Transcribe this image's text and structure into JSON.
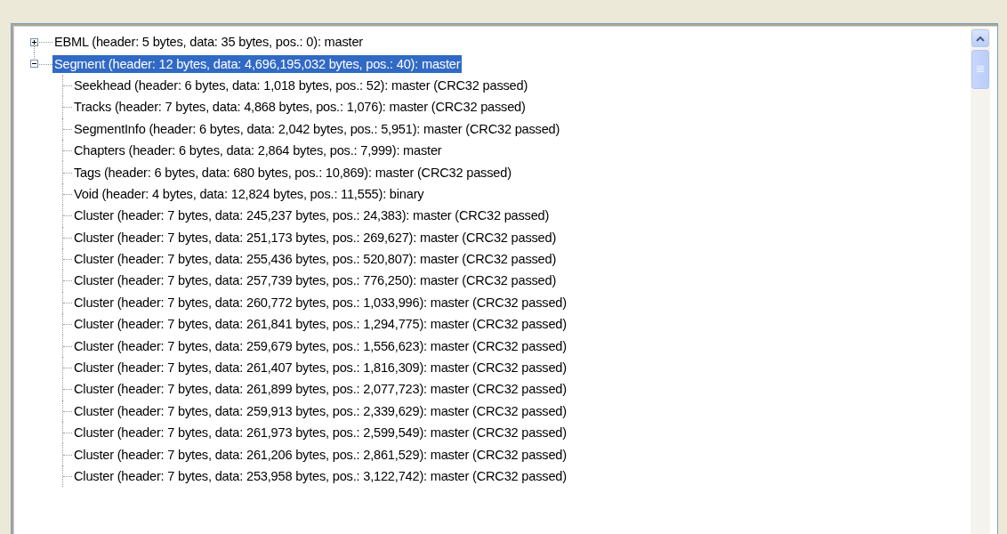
{
  "tree": [
    {
      "label": "EBML (header: 5 bytes, data: 35 bytes, pos.: 0): master",
      "expanded": false,
      "selected": false
    },
    {
      "label": "Segment (header: 12 bytes, data: 4,696,195,032 bytes, pos.: 40): master",
      "expanded": true,
      "selected": true,
      "children": [
        {
          "label": "Seekhead (header: 6 bytes, data: 1,018 bytes, pos.: 52): master (CRC32 passed)",
          "selected": false
        },
        {
          "label": "Tracks (header: 7 bytes, data: 4,868 bytes, pos.: 1,076): master (CRC32 passed)",
          "selected": false
        },
        {
          "label": "SegmentInfo (header: 6 bytes, data: 2,042 bytes, pos.: 5,951): master (CRC32 passed)",
          "selected": false
        },
        {
          "label": "Chapters (header: 6 bytes, data: 2,864 bytes, pos.: 7,999): master",
          "selected": false
        },
        {
          "label": "Tags (header: 6 bytes, data: 680 bytes, pos.: 10,869): master (CRC32 passed)",
          "selected": false
        },
        {
          "label": "Void (header: 4 bytes, data: 12,824 bytes, pos.: 11,555): binary",
          "selected": false
        },
        {
          "label": "Cluster (header: 7 bytes, data: 245,237 bytes, pos.: 24,383): master (CRC32 passed)",
          "selected": false
        },
        {
          "label": "Cluster (header: 7 bytes, data: 251,173 bytes, pos.: 269,627): master (CRC32 passed)",
          "selected": false
        },
        {
          "label": "Cluster (header: 7 bytes, data: 255,436 bytes, pos.: 520,807): master (CRC32 passed)",
          "selected": false
        },
        {
          "label": "Cluster (header: 7 bytes, data: 257,739 bytes, pos.: 776,250): master (CRC32 passed)",
          "selected": false
        },
        {
          "label": "Cluster (header: 7 bytes, data: 260,772 bytes, pos.: 1,033,996): master (CRC32 passed)",
          "selected": false
        },
        {
          "label": "Cluster (header: 7 bytes, data: 261,841 bytes, pos.: 1,294,775): master (CRC32 passed)",
          "selected": false
        },
        {
          "label": "Cluster (header: 7 bytes, data: 259,679 bytes, pos.: 1,556,623): master (CRC32 passed)",
          "selected": false
        },
        {
          "label": "Cluster (header: 7 bytes, data: 261,407 bytes, pos.: 1,816,309): master (CRC32 passed)",
          "selected": false
        },
        {
          "label": "Cluster (header: 7 bytes, data: 261,899 bytes, pos.: 2,077,723): master (CRC32 passed)",
          "selected": false
        },
        {
          "label": "Cluster (header: 7 bytes, data: 259,913 bytes, pos.: 2,339,629): master (CRC32 passed)",
          "selected": false
        },
        {
          "label": "Cluster (header: 7 bytes, data: 261,973 bytes, pos.: 2,599,549): master (CRC32 passed)",
          "selected": false
        },
        {
          "label": "Cluster (header: 7 bytes, data: 261,206 bytes, pos.: 2,861,529): master (CRC32 passed)",
          "selected": false
        },
        {
          "label": "Cluster (header: 7 bytes, data: 253,958 bytes, pos.: 3,122,742): master (CRC32 passed)",
          "selected": false
        }
      ]
    }
  ]
}
